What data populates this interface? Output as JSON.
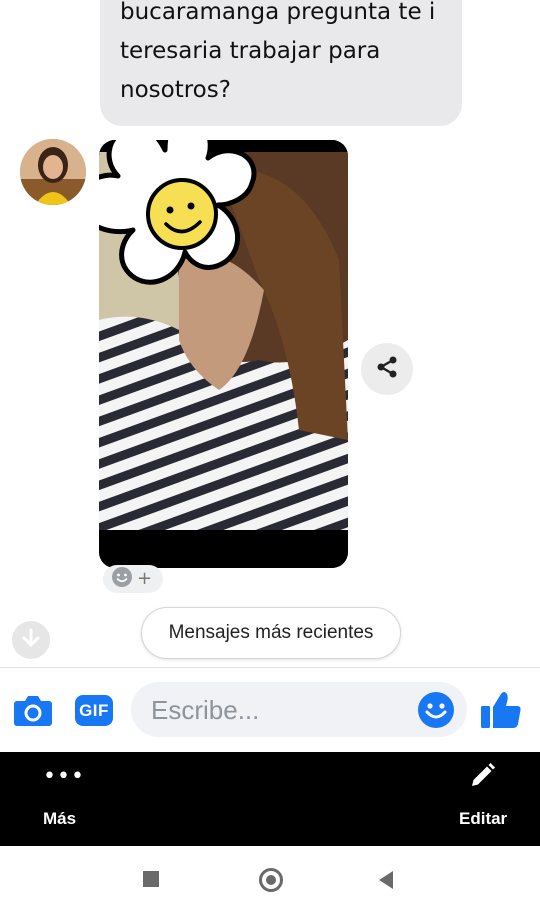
{
  "message": {
    "lines": [
      "bucaramanga pregunta te i",
      "teresaria trabajar para",
      "nosotros?"
    ]
  },
  "banner": {
    "label": "Mensajes más recientes"
  },
  "composer": {
    "placeholder": "Escribe...",
    "gif_label": "GIF"
  },
  "actions": {
    "more_dots": "•••",
    "more_label": "Más",
    "edit_label": "Editar"
  },
  "icons": {
    "camera": "camera-icon",
    "like": "thumbs-up-icon",
    "emoji": "emoji-icon",
    "share": "share-icon",
    "scroll": "arrow-down-icon",
    "edit": "pencil-icon"
  },
  "colors": {
    "accent": "#1877f2",
    "bubble": "#e9e9eb",
    "bar": "#000000"
  }
}
